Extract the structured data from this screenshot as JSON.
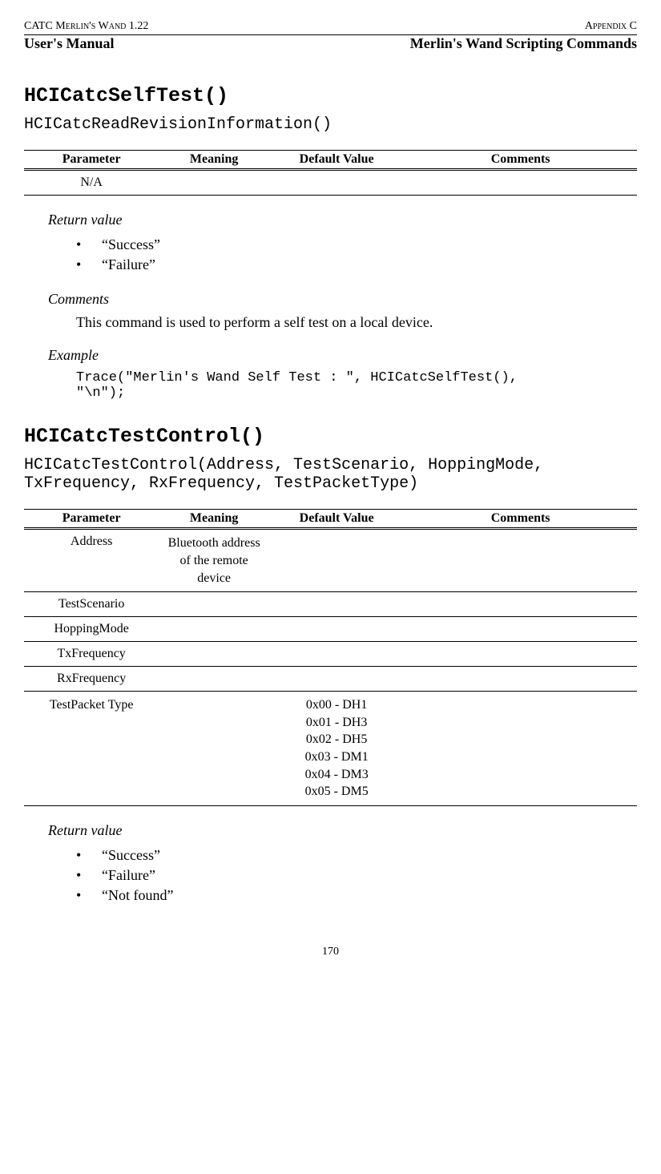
{
  "header": {
    "top_left": "CATC Merlin's Wand 1.22",
    "top_right": "Appendix C",
    "sub_left": "User's Manual",
    "sub_right": "Merlin's Wand Scripting Commands"
  },
  "func1": {
    "name": "HCICatcSelfTest()",
    "signature": "HCICatcReadRevisionInformation()",
    "table": {
      "headers": {
        "p": "Parameter",
        "m": "Meaning",
        "d": "Default Value",
        "c": "Comments"
      },
      "rows": [
        {
          "p": "N/A",
          "m": "",
          "d": "",
          "c": ""
        }
      ]
    },
    "return_label": "Return value",
    "returns": [
      "“Success”",
      "“Failure”"
    ],
    "comments_label": "Comments",
    "comments_text": "This command is used to perform a self test on a local device.",
    "example_label": "Example",
    "example_code": "Trace(\"Merlin's Wand Self Test : \", HCICatcSelfTest(),\n\"\\n\");"
  },
  "func2": {
    "name": "HCICatcTestControl()",
    "signature": "HCICatcTestControl(Address, TestScenario, HoppingMode, TxFrequency, RxFrequency, TestPacketType)",
    "table": {
      "headers": {
        "p": "Parameter",
        "m": "Meaning",
        "d": "Default Value",
        "c": "Comments"
      },
      "rows": [
        {
          "p": "Address",
          "m": "Bluetooth address of the remote device",
          "d": "",
          "c": ""
        },
        {
          "p": "TestScenario",
          "m": "",
          "d": "",
          "c": ""
        },
        {
          "p": "HoppingMode",
          "m": "",
          "d": "",
          "c": ""
        },
        {
          "p": "TxFrequency",
          "m": "",
          "d": "",
          "c": ""
        },
        {
          "p": "RxFrequency",
          "m": "",
          "d": "",
          "c": ""
        },
        {
          "p": "TestPacket Type",
          "m": "",
          "d": "0x00 - DH1\n0x01 - DH3\n0x02 - DH5\n0x03 - DM1\n0x04 - DM3\n0x05 - DM5",
          "c": ""
        }
      ]
    },
    "return_label": "Return value",
    "returns": [
      "“Success”",
      "“Failure”",
      "“Not found”"
    ]
  },
  "page_number": "170"
}
